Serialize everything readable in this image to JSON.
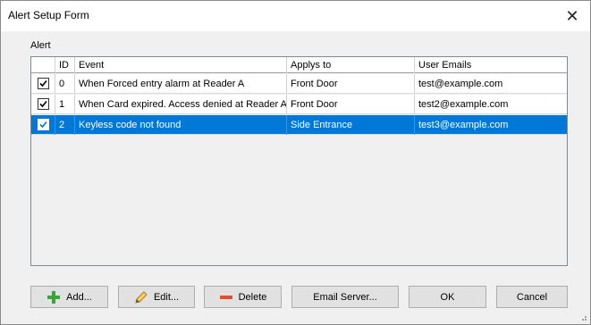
{
  "window": {
    "title": "Alert Setup Form",
    "close_glyph": "✕"
  },
  "alert_group": {
    "label": "Alert"
  },
  "table": {
    "columns": [
      "",
      "ID",
      "Event",
      "Applys to",
      "User Emails"
    ],
    "rows": [
      {
        "checked": true,
        "id": "0",
        "event": "When Forced entry alarm at Reader A",
        "applys_to": "Front Door",
        "email": "test@example.com",
        "selected": false
      },
      {
        "checked": true,
        "id": "1",
        "event": "When Card expired. Access denied at Reader A",
        "applys_to": "Front Door",
        "email": "test2@example.com",
        "selected": false
      },
      {
        "checked": true,
        "id": "2",
        "event": "Keyless code not found",
        "applys_to": "Side Entrance",
        "email": "test3@example.com",
        "selected": true
      }
    ]
  },
  "buttons": {
    "add": "Add...",
    "edit": "Edit...",
    "delete": "Delete",
    "email_server": "Email Server...",
    "ok": "OK",
    "cancel": "Cancel"
  },
  "icons": {
    "add": "plus-icon",
    "edit": "pencil-icon",
    "delete": "minus-icon"
  },
  "colors": {
    "selection": "#0078d7",
    "add_icon": "#3aa33a",
    "delete_icon": "#e05030",
    "edit_icon": "#e0a020"
  }
}
